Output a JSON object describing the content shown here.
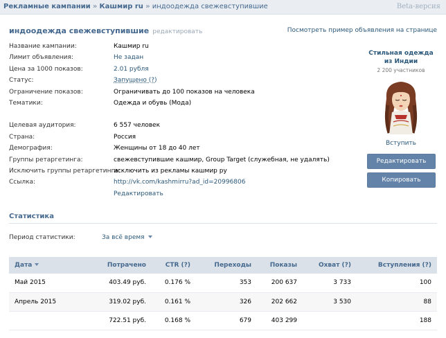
{
  "breadcrumb": {
    "root": "Рекламные кампании",
    "campaign": "Кашмир ru",
    "current": "индоодежда свежевступившие",
    "sep": "»"
  },
  "beta_label": "Beta-версия",
  "ad": {
    "title": "индоодежда свежевступившие",
    "edit_label": "редактировать",
    "preview_link": "Посмотреть пример объявления на странице"
  },
  "details": [
    {
      "label": "Название кампании:",
      "value": "Кашмир ru",
      "style": "text"
    },
    {
      "label": "Лимит объявления:",
      "value": "Не задан",
      "style": "link"
    },
    {
      "label": "Цена за 1000 показов:",
      "value": "2.01 рубля",
      "style": "link"
    },
    {
      "label": "Статус:",
      "value": "Запущено (?)",
      "style": "underline"
    },
    {
      "label": "Ограничение показов:",
      "value": "Ограничивать до 100 показов на человека",
      "style": "text"
    },
    {
      "label": "Тематики:",
      "value": "Одежда и обувь (Мода)",
      "style": "text"
    },
    {
      "label": "Целевая аудитория:",
      "value": "6 557 человек",
      "style": "text"
    },
    {
      "label": "Страна:",
      "value": "Россия",
      "style": "text"
    },
    {
      "label": "Демография:",
      "value": "Женщины от 18 до 40 лет",
      "style": "text"
    },
    {
      "label": "Группы ретаргетинга:",
      "value": "свежевступившие кашмир, Group Target (служебная, не удалять)",
      "style": "text"
    },
    {
      "label": "Исключить группы ретаргетинга:",
      "value": "исключить из рекламы кашмир ру",
      "style": "text"
    },
    {
      "label": "Ссылка:",
      "value": "http://vk.com/kashmirru?ad_id=20996806",
      "style": "link"
    }
  ],
  "edit_link": "Редактировать",
  "promo": {
    "title": "Стильная одежда из Индии",
    "subtitle": "2 200 участников",
    "join_label": "Вступить"
  },
  "buttons": {
    "edit": "Редактировать",
    "copy": "Копировать"
  },
  "stats": {
    "title": "Статистика",
    "period_label": "Период статистики:",
    "period_value": "За всё время",
    "columns": [
      "Дата",
      "Потрачено",
      "CTR (?)",
      "Переходы",
      "Показы",
      "Охват (?)",
      "Вступления (?)"
    ],
    "rows": [
      [
        "Май 2015",
        "403.49 руб.",
        "0.176 %",
        "353",
        "200 637",
        "3 733",
        "100"
      ],
      [
        "Апрель 2015",
        "319.02 руб.",
        "0.161 %",
        "326",
        "202 662",
        "3 530",
        "88"
      ],
      [
        "",
        "722.51 руб.",
        "0.168 %",
        "679",
        "403 299",
        "",
        "188"
      ]
    ]
  },
  "colors": {
    "accent": "#45688e",
    "button": "#6383a8",
    "header_bg": "#dae1e8",
    "topbar_bg": "#eaeef3"
  }
}
